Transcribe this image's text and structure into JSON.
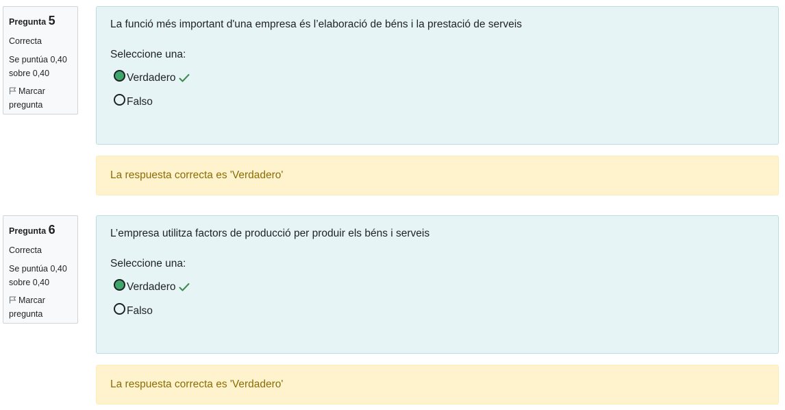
{
  "questions": [
    {
      "label": "Pregunta",
      "number": "5",
      "state": "Correcta",
      "grade_line1": "Se puntúa 0,40",
      "grade_line2": "sobre 0,40",
      "flag_line1": "Marcar",
      "flag_line2": "pregunta",
      "text": "La funció més important d'una empresa és l’elaboració de béns i la prestació de serveis",
      "prompt": "Seleccione una:",
      "options": [
        {
          "label": "Verdadero",
          "checked": true,
          "correct_mark": true
        },
        {
          "label": "Falso",
          "checked": false,
          "correct_mark": false
        }
      ],
      "feedback": "La respuesta correcta es 'Verdadero'"
    },
    {
      "label": "Pregunta",
      "number": "6",
      "state": "Correcta",
      "grade_line1": "Se puntúa 0,40",
      "grade_line2": "sobre 0,40",
      "flag_line1": "Marcar",
      "flag_line2": "pregunta",
      "text": "L’empresa utilitza factors de producció per produir els béns i serveis",
      "prompt": "Seleccione una:",
      "options": [
        {
          "label": "Verdadero",
          "checked": true,
          "correct_mark": true
        },
        {
          "label": "Falso",
          "checked": false,
          "correct_mark": false
        }
      ],
      "feedback": "La respuesta correcta es 'Verdadero'"
    }
  ],
  "icons": {
    "flag": "flag-icon",
    "correct": "check-icon"
  },
  "colors": {
    "content_bg": "#e6f4f6",
    "feedback_bg": "#fef3cd",
    "feedback_text": "#8a6d05",
    "radio_checked": "#3fa56a",
    "check_mark": "#3c8a4f"
  }
}
